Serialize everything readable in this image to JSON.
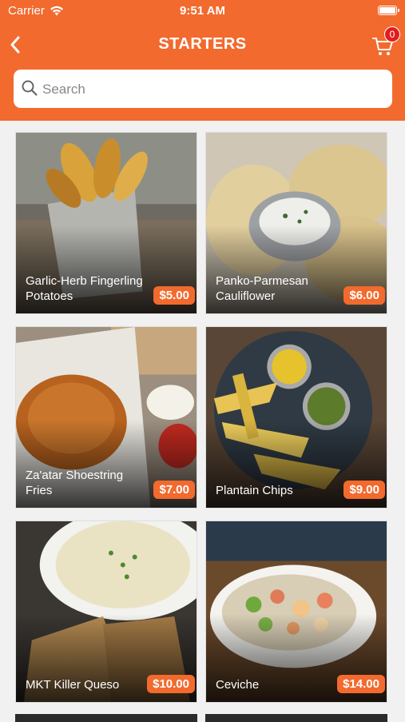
{
  "status": {
    "carrier": "Carrier",
    "time": "9:51 AM"
  },
  "nav": {
    "title": "STARTERS",
    "cart_count": "0"
  },
  "search": {
    "placeholder": "Search"
  },
  "colors": {
    "brand": "#f26a2e",
    "badge": "#e11d1d"
  },
  "items": [
    {
      "name": "Garlic-Herb Fingerling Potatoes",
      "price": "$5.00"
    },
    {
      "name": "Panko-Parmesan Cauliflower",
      "price": "$6.00"
    },
    {
      "name": "Za'atar Shoestring Fries",
      "price": "$7.00"
    },
    {
      "name": "Plantain Chips",
      "price": "$9.00"
    },
    {
      "name": "MKT Killer Queso",
      "price": "$10.00"
    },
    {
      "name": "Ceviche",
      "price": "$14.00"
    }
  ]
}
